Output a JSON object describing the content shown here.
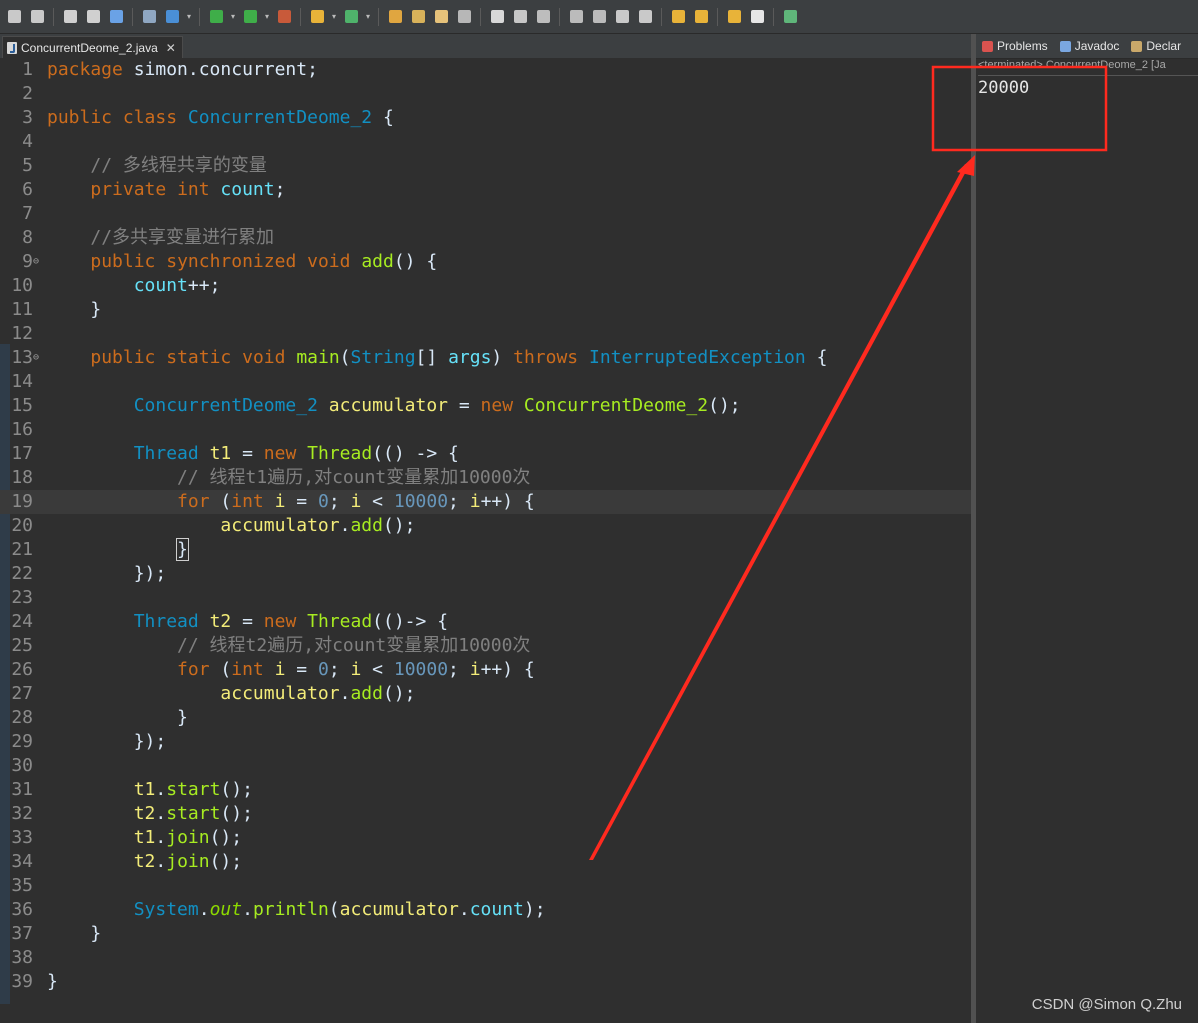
{
  "toolbar": {
    "icons": [
      "save-icon",
      "save-all-icon",
      "undo-icon",
      "redo-icon",
      "outline-icon",
      "search-icon",
      "debug-icon",
      "run-icon",
      "coverage-icon",
      "external-tools-icon",
      "new-class-icon",
      "refresh-icon",
      "open-type-icon",
      "open-resource-icon",
      "pen-icon",
      "search-file-icon",
      "brush-icon",
      "annotation-icon",
      "history-icon",
      "markup-icon",
      "paragraph-icon",
      "pin-icon",
      "toggle-icon",
      "back-edit-icon",
      "forward-edit-icon",
      "back-icon",
      "forward-icon",
      "new-window-icon"
    ],
    "accent_colors": {
      "run": "#3fae49",
      "debug": "#4a8fd6",
      "save": "#c9c9c9",
      "warn": "#e8b339"
    }
  },
  "editor": {
    "tab_label": "ConcurrentDeome_2.java",
    "current_line": 19,
    "lines": [
      {
        "n": "1",
        "tokens": [
          [
            "kw",
            "package"
          ],
          [
            "ident",
            " simon.concurrent;"
          ]
        ]
      },
      {
        "n": "2",
        "tokens": []
      },
      {
        "n": "3",
        "tokens": [
          [
            "kw",
            "public"
          ],
          [
            "ident",
            " "
          ],
          [
            "kw",
            "class"
          ],
          [
            "ident",
            " "
          ],
          [
            "cls",
            "ConcurrentDeome_2"
          ],
          [
            "ident",
            " {"
          ]
        ]
      },
      {
        "n": "4",
        "tokens": []
      },
      {
        "n": "5",
        "tokens": [
          [
            "ident",
            "    "
          ],
          [
            "cm",
            "// 多线程共享的变量"
          ]
        ]
      },
      {
        "n": "6",
        "tokens": [
          [
            "ident",
            "    "
          ],
          [
            "kw",
            "private"
          ],
          [
            "ident",
            " "
          ],
          [
            "kw",
            "int"
          ],
          [
            "ident",
            " "
          ],
          [
            "fld",
            "count"
          ],
          [
            "ident",
            ";"
          ]
        ]
      },
      {
        "n": "7",
        "tokens": []
      },
      {
        "n": "8",
        "tokens": [
          [
            "ident",
            "    "
          ],
          [
            "cm",
            "//多共享变量进行累加"
          ]
        ]
      },
      {
        "n": "9",
        "fold": "⊖",
        "tokens": [
          [
            "ident",
            "    "
          ],
          [
            "kw",
            "public"
          ],
          [
            "ident",
            " "
          ],
          [
            "kw",
            "synchronized"
          ],
          [
            "ident",
            " "
          ],
          [
            "kw",
            "void"
          ],
          [
            "ident",
            " "
          ],
          [
            "fn",
            "add"
          ],
          [
            "ident",
            "() {"
          ]
        ]
      },
      {
        "n": "10",
        "tokens": [
          [
            "ident",
            "        "
          ],
          [
            "fld",
            "count"
          ],
          [
            "ident",
            "++;"
          ]
        ]
      },
      {
        "n": "11",
        "tokens": [
          [
            "ident",
            "    }"
          ]
        ]
      },
      {
        "n": "12",
        "tokens": []
      },
      {
        "n": "13",
        "fold": "⊖",
        "tokens": [
          [
            "ident",
            "    "
          ],
          [
            "kw",
            "public"
          ],
          [
            "ident",
            " "
          ],
          [
            "kw",
            "static"
          ],
          [
            "ident",
            " "
          ],
          [
            "kw",
            "void"
          ],
          [
            "ident",
            " "
          ],
          [
            "fn",
            "main"
          ],
          [
            "ident",
            "("
          ],
          [
            "cls",
            "String"
          ],
          [
            "ident",
            "[] "
          ],
          [
            "fld",
            "args"
          ],
          [
            "ident",
            ") "
          ],
          [
            "kw",
            "throws"
          ],
          [
            "ident",
            " "
          ],
          [
            "cls",
            "InterruptedException"
          ],
          [
            "ident",
            " {"
          ]
        ]
      },
      {
        "n": "14",
        "tokens": []
      },
      {
        "n": "15",
        "tokens": [
          [
            "ident",
            "        "
          ],
          [
            "cls",
            "ConcurrentDeome_2"
          ],
          [
            "ident",
            " "
          ],
          [
            "var",
            "accumulator"
          ],
          [
            "ident",
            " = "
          ],
          [
            "kw",
            "new"
          ],
          [
            "ident",
            " "
          ],
          [
            "fn",
            "ConcurrentDeome_2"
          ],
          [
            "ident",
            "();"
          ]
        ]
      },
      {
        "n": "16",
        "tokens": []
      },
      {
        "n": "17",
        "tokens": [
          [
            "ident",
            "        "
          ],
          [
            "cls",
            "Thread"
          ],
          [
            "ident",
            " "
          ],
          [
            "var",
            "t1"
          ],
          [
            "ident",
            " = "
          ],
          [
            "kw",
            "new"
          ],
          [
            "ident",
            " "
          ],
          [
            "fn",
            "Thread"
          ],
          [
            "ident",
            "(() -> {"
          ]
        ]
      },
      {
        "n": "18",
        "tokens": [
          [
            "ident",
            "            "
          ],
          [
            "cm",
            "// 线程t1遍历,对count变量累加10000次"
          ]
        ]
      },
      {
        "n": "19",
        "tokens": [
          [
            "ident",
            "            "
          ],
          [
            "kw",
            "for"
          ],
          [
            "ident",
            " ("
          ],
          [
            "kw",
            "int"
          ],
          [
            "ident",
            " "
          ],
          [
            "var",
            "i"
          ],
          [
            "ident",
            " = "
          ],
          [
            "num",
            "0"
          ],
          [
            "ident",
            "; "
          ],
          [
            "var",
            "i"
          ],
          [
            "ident",
            " < "
          ],
          [
            "num",
            "10000"
          ],
          [
            "ident",
            "; "
          ],
          [
            "var",
            "i"
          ],
          [
            "ident",
            "++) {"
          ]
        ]
      },
      {
        "n": "20",
        "tokens": [
          [
            "ident",
            "                "
          ],
          [
            "var",
            "accumulator"
          ],
          [
            "ident",
            "."
          ],
          [
            "fn",
            "add"
          ],
          [
            "ident",
            "();"
          ]
        ]
      },
      {
        "n": "21",
        "tokens": [
          [
            "ident",
            "            "
          ],
          [
            "caret",
            "}"
          ]
        ]
      },
      {
        "n": "22",
        "tokens": [
          [
            "ident",
            "        });"
          ]
        ]
      },
      {
        "n": "23",
        "tokens": []
      },
      {
        "n": "24",
        "tokens": [
          [
            "ident",
            "        "
          ],
          [
            "cls",
            "Thread"
          ],
          [
            "ident",
            " "
          ],
          [
            "var",
            "t2"
          ],
          [
            "ident",
            " = "
          ],
          [
            "kw",
            "new"
          ],
          [
            "ident",
            " "
          ],
          [
            "fn",
            "Thread"
          ],
          [
            "ident",
            "(()-> {"
          ]
        ]
      },
      {
        "n": "25",
        "tokens": [
          [
            "ident",
            "            "
          ],
          [
            "cm",
            "// 线程t2遍历,对count变量累加10000次"
          ]
        ]
      },
      {
        "n": "26",
        "tokens": [
          [
            "ident",
            "            "
          ],
          [
            "kw",
            "for"
          ],
          [
            "ident",
            " ("
          ],
          [
            "kw",
            "int"
          ],
          [
            "ident",
            " "
          ],
          [
            "var",
            "i"
          ],
          [
            "ident",
            " = "
          ],
          [
            "num",
            "0"
          ],
          [
            "ident",
            "; "
          ],
          [
            "var",
            "i"
          ],
          [
            "ident",
            " < "
          ],
          [
            "num",
            "10000"
          ],
          [
            "ident",
            "; "
          ],
          [
            "var",
            "i"
          ],
          [
            "ident",
            "++) {"
          ]
        ]
      },
      {
        "n": "27",
        "tokens": [
          [
            "ident",
            "                "
          ],
          [
            "var",
            "accumulator"
          ],
          [
            "ident",
            "."
          ],
          [
            "fn",
            "add"
          ],
          [
            "ident",
            "();"
          ]
        ]
      },
      {
        "n": "28",
        "tokens": [
          [
            "ident",
            "            }"
          ]
        ]
      },
      {
        "n": "29",
        "tokens": [
          [
            "ident",
            "        });"
          ]
        ]
      },
      {
        "n": "30",
        "tokens": []
      },
      {
        "n": "31",
        "tokens": [
          [
            "ident",
            "        "
          ],
          [
            "var",
            "t1"
          ],
          [
            "ident",
            "."
          ],
          [
            "fn",
            "start"
          ],
          [
            "ident",
            "();"
          ]
        ]
      },
      {
        "n": "32",
        "tokens": [
          [
            "ident",
            "        "
          ],
          [
            "var",
            "t2"
          ],
          [
            "ident",
            "."
          ],
          [
            "fn",
            "start"
          ],
          [
            "ident",
            "();"
          ]
        ]
      },
      {
        "n": "33",
        "tokens": [
          [
            "ident",
            "        "
          ],
          [
            "var",
            "t1"
          ],
          [
            "ident",
            "."
          ],
          [
            "fn",
            "join"
          ],
          [
            "ident",
            "();"
          ]
        ]
      },
      {
        "n": "34",
        "tokens": [
          [
            "ident",
            "        "
          ],
          [
            "var",
            "t2"
          ],
          [
            "ident",
            "."
          ],
          [
            "fn",
            "join"
          ],
          [
            "ident",
            "();"
          ]
        ]
      },
      {
        "n": "35",
        "tokens": []
      },
      {
        "n": "36",
        "tokens": [
          [
            "ident",
            "        "
          ],
          [
            "cls",
            "System"
          ],
          [
            "ident",
            "."
          ],
          [
            "st",
            "out"
          ],
          [
            "ident",
            "."
          ],
          [
            "fn",
            "println"
          ],
          [
            "ident",
            "("
          ],
          [
            "var",
            "accumulator"
          ],
          [
            "ident",
            "."
          ],
          [
            "fld",
            "count"
          ],
          [
            "ident",
            ");"
          ]
        ]
      },
      {
        "n": "37",
        "tokens": [
          [
            "ident",
            "    }"
          ]
        ]
      },
      {
        "n": "38",
        "tokens": []
      },
      {
        "n": "39",
        "tokens": [
          [
            "ident",
            "}"
          ]
        ]
      }
    ]
  },
  "panel": {
    "tabs": [
      {
        "label": "Problems",
        "icon": "problems-icon",
        "color": "#d9534f"
      },
      {
        "label": "Javadoc",
        "icon": "javadoc-icon",
        "color": "#7aa7e0"
      },
      {
        "label": "Declar",
        "icon": "declaration-icon",
        "color": "#c9a86a"
      }
    ],
    "console_header": "<terminated> ConcurrentDeome_2 [Ja",
    "console_output": "20000"
  },
  "annotation": {
    "color": "#ff2a1f"
  },
  "watermark": "CSDN @Simon Q.Zhu"
}
